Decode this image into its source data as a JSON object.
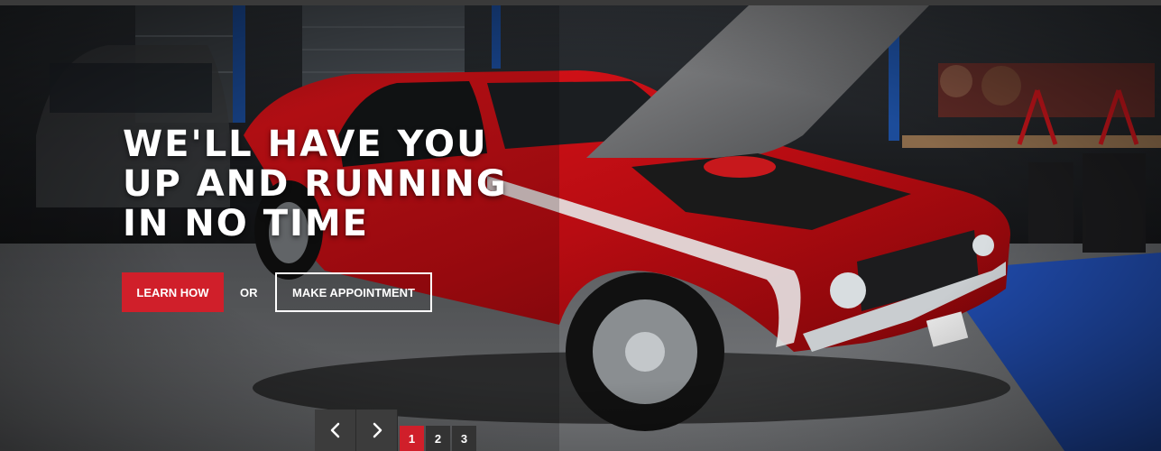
{
  "hero": {
    "headline": [
      "WE'LL HAVE YOU",
      "UP AND RUNNING",
      "IN NO TIME"
    ],
    "learn_label": "LEARN HOW",
    "or_label": "OR",
    "appointment_label": "MAKE APPOINTMENT"
  },
  "slider": {
    "prev_icon": "chevron-left-icon",
    "next_icon": "chevron-right-icon",
    "pages": [
      "1",
      "2",
      "3"
    ],
    "active_page": "1"
  },
  "colors": {
    "accent": "#d01f2a",
    "text": "#ffffff",
    "nav_bg": "#3c3c3c"
  }
}
